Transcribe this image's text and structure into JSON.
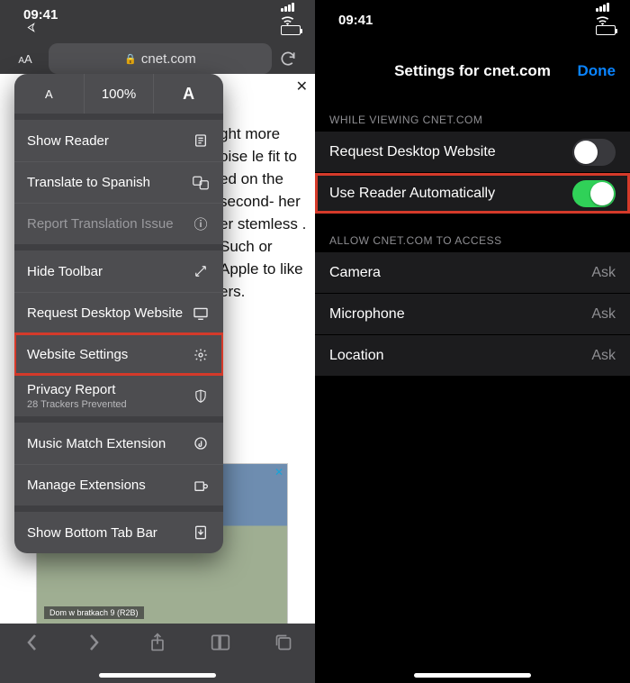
{
  "status": {
    "time": "09:41"
  },
  "left": {
    "url_domain": "cnet.com",
    "zoom": {
      "smallA": "A",
      "percent": "100%",
      "bigA": "A"
    },
    "menu": {
      "show_reader": "Show Reader",
      "translate": "Translate to Spanish",
      "report_translation": "Report Translation Issue",
      "hide_toolbar": "Hide Toolbar",
      "request_desktop": "Request Desktop Website",
      "website_settings": "Website Settings",
      "privacy_report": "Privacy Report",
      "privacy_sub": "28 Trackers Prevented",
      "music_match": "Music Match Extension",
      "manage_ext": "Manage Extensions",
      "bottom_tab_bar": "Show Bottom Tab Bar"
    },
    "page_snippet": "ght more oise le fit to ed on the second- her er stemless . Such or Apple to like ers.",
    "ad_caption": "Dom w bratkach 9 (R2B)"
  },
  "right": {
    "title": "Settings for cnet.com",
    "done": "Done",
    "section_view": "WHILE VIEWING CNET.COM",
    "request_desktop": "Request Desktop Website",
    "use_reader": "Use Reader Automatically",
    "section_access": "ALLOW CNET.COM TO ACCESS",
    "camera": {
      "label": "Camera",
      "value": "Ask"
    },
    "microphone": {
      "label": "Microphone",
      "value": "Ask"
    },
    "location": {
      "label": "Location",
      "value": "Ask"
    }
  }
}
